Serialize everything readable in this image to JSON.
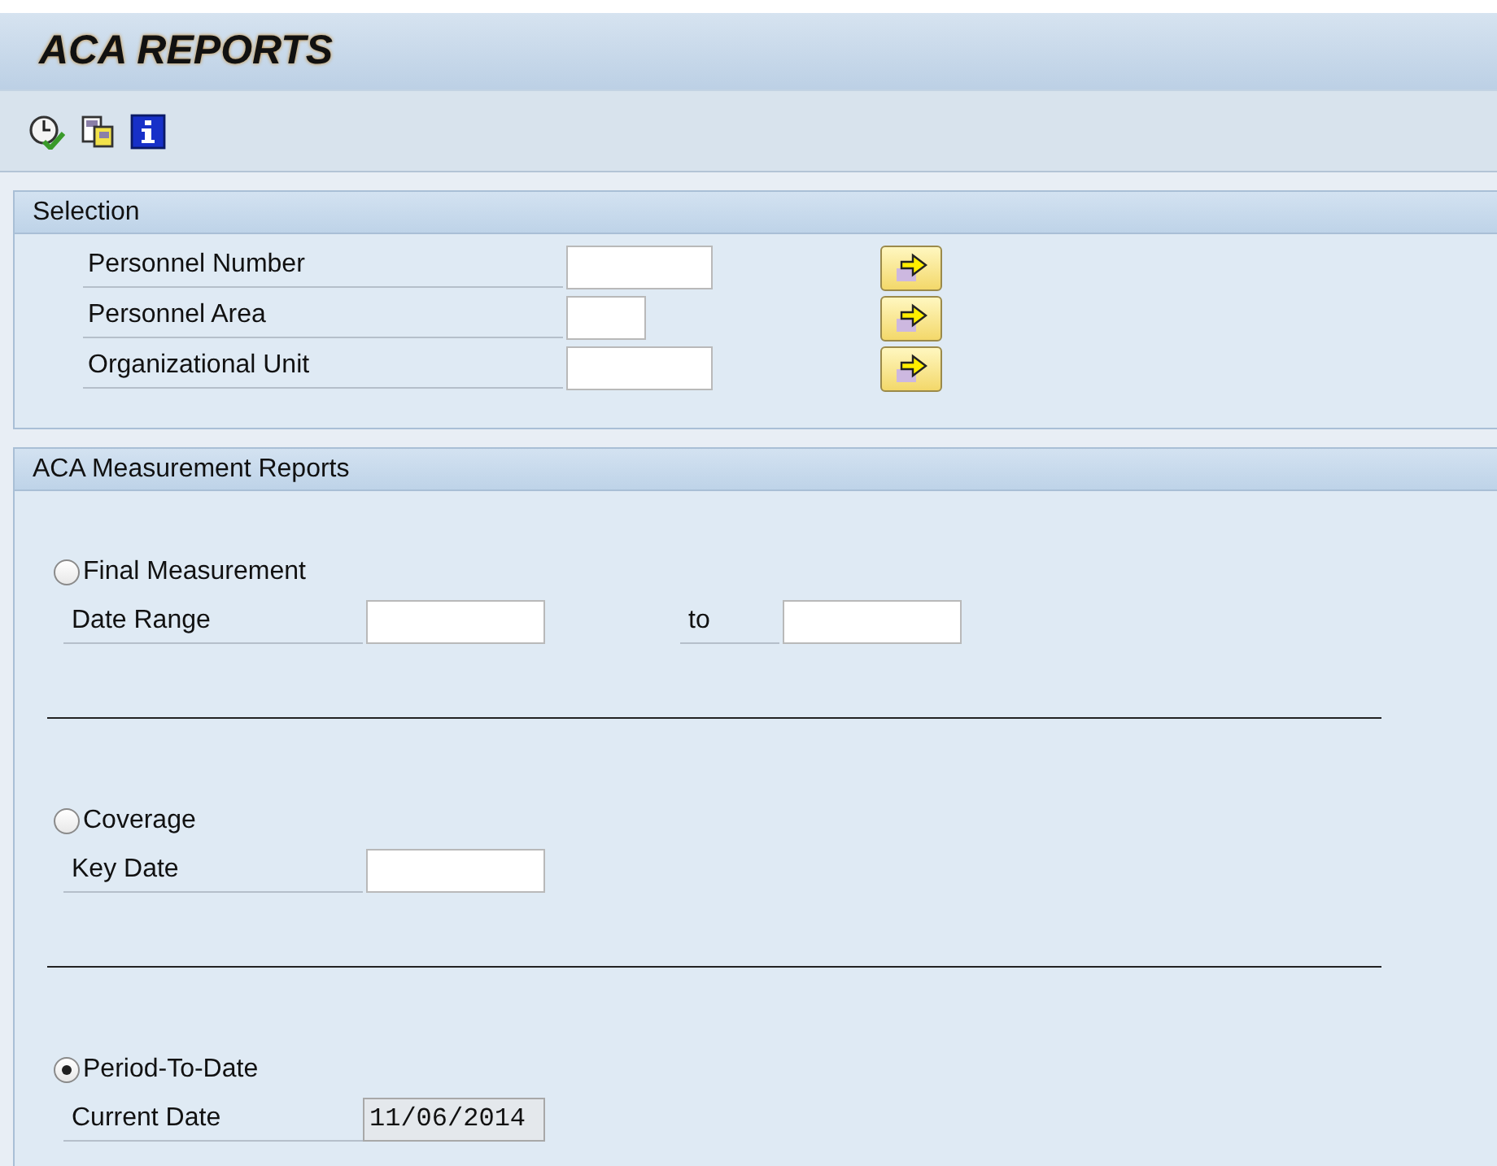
{
  "window": {
    "title": "ACA REPORTS"
  },
  "selection": {
    "title": "Selection",
    "rows": [
      {
        "label": "Personnel Number",
        "value": ""
      },
      {
        "label": "Personnel Area",
        "value": ""
      },
      {
        "label": "Organizational Unit",
        "value": ""
      }
    ]
  },
  "measurement": {
    "title": "ACA Measurement Reports",
    "options": [
      {
        "label": "Final Measurement",
        "selected": false,
        "fields": [
          {
            "label": "Date Range",
            "disabled": false
          },
          {
            "label": "to",
            "disabled": false
          }
        ]
      },
      {
        "label": "Coverage",
        "selected": false,
        "fields": [
          {
            "label": "Key Date",
            "disabled": false
          }
        ]
      },
      {
        "label": "Period-To-Date",
        "selected": true,
        "fields": [
          {
            "label": "Current Date",
            "value": "11/06/2014",
            "disabled": true
          }
        ]
      }
    ]
  }
}
